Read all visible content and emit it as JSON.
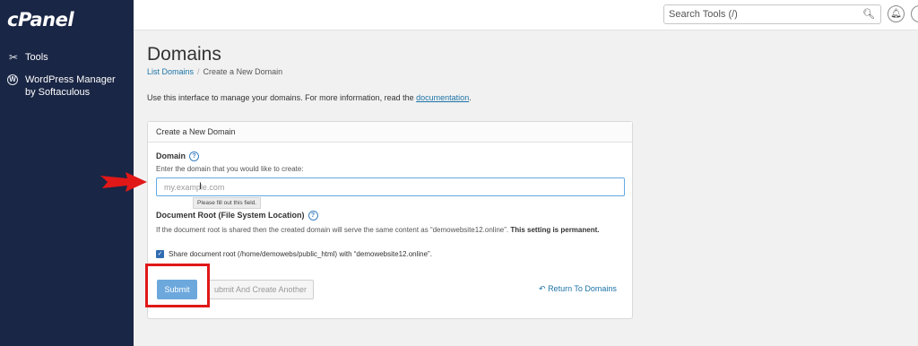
{
  "app": {
    "brand": "cPanel"
  },
  "sidebar": {
    "items": [
      {
        "label": "Tools",
        "icon": "tools-icon"
      },
      {
        "label": "WordPress Manager by Softaculous",
        "label_line1": "WordPress Manager",
        "label_line2": "by Softaculous",
        "icon": "wordpress-icon"
      }
    ]
  },
  "topbar": {
    "search_placeholder": "Search Tools (/)",
    "search_icon": "search-icon",
    "notifications_icon": "bell-icon"
  },
  "page": {
    "title": "Domains",
    "breadcrumb": {
      "parent": "List Domains",
      "separator": "/",
      "current": "Create a New Domain"
    },
    "intro_text": "Use this interface to manage your domains. For more information, read the ",
    "intro_link": "documentation",
    "intro_end": "."
  },
  "panel": {
    "heading": "Create a New Domain",
    "domain_label": "Domain",
    "domain_hint": "Enter the domain that you would like to create:",
    "domain_placeholder": "my.example.com",
    "validation_tooltip": "Please fill out this field.",
    "docroot_label": "Document Root (File System Location)",
    "docroot_text": "If the document root is shared then the created domain will serve the same content as “demowebsite12.online”.",
    "docroot_bold": "This setting is permanent.",
    "share_checkbox_label": "Share document root (/home/demowebs/public_html) with “demowebsite12.online”.",
    "share_checked": true,
    "submit_label": "Submit",
    "submit_another_label": "ubmit And Create Another",
    "return_label": "Return To Domains"
  },
  "colors": {
    "sidebar_bg": "#1a2645",
    "link": "#1d73a7",
    "primary_button": "#5e9fda",
    "annotation_red": "#e01818"
  }
}
